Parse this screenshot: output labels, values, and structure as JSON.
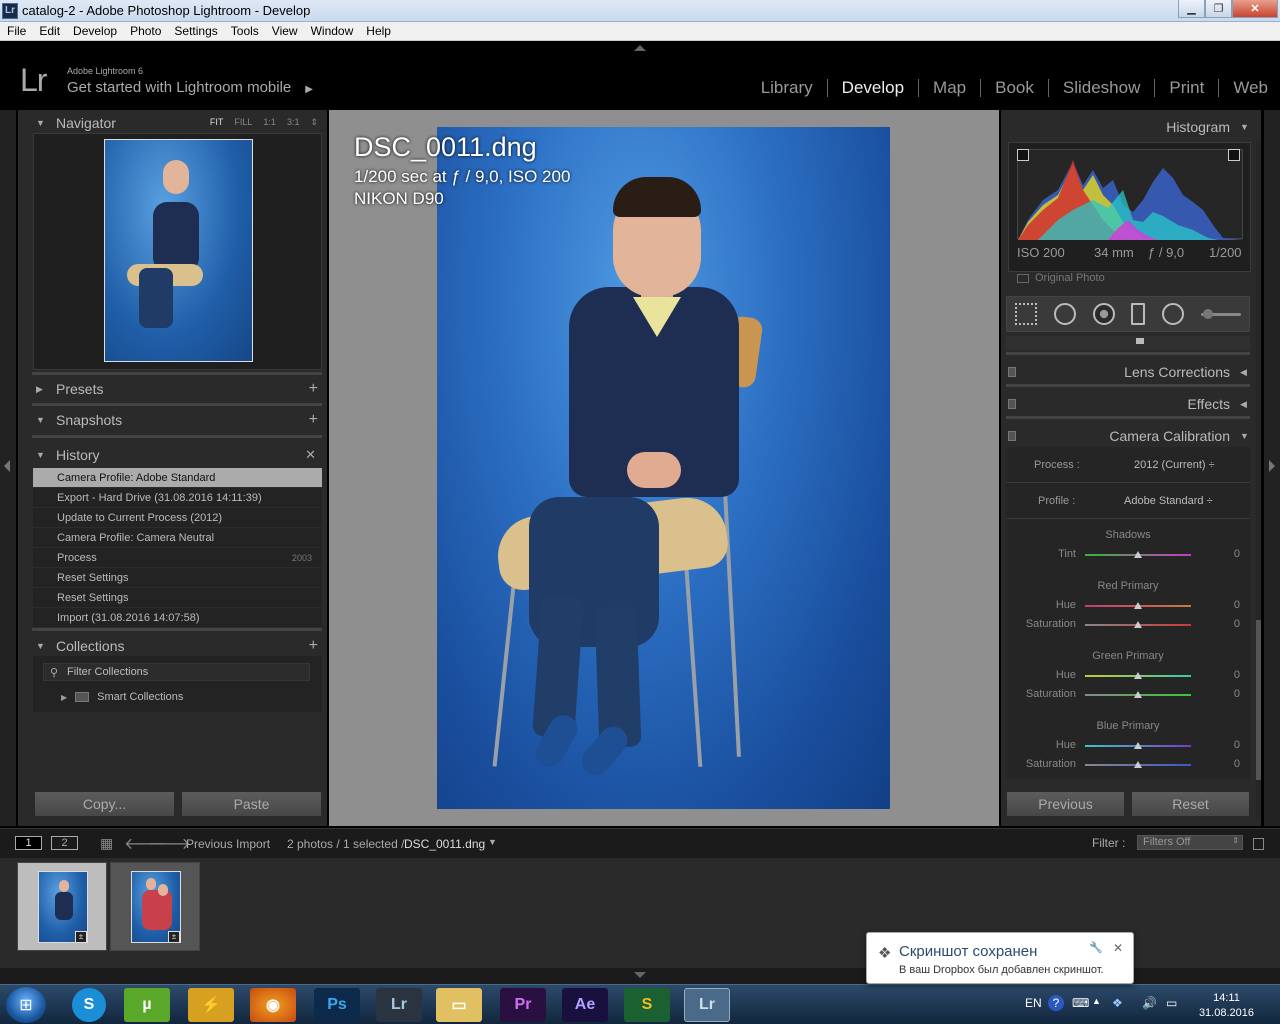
{
  "window": {
    "title": "catalog-2 - Adobe Photoshop Lightroom - Develop",
    "app_icon": "Lr"
  },
  "menu": [
    "File",
    "Edit",
    "Develop",
    "Photo",
    "Settings",
    "Tools",
    "View",
    "Window",
    "Help"
  ],
  "header": {
    "logo": "Lr",
    "product": "Adobe Lightroom 6",
    "subtitle": "Get started with Lightroom mobile",
    "modules": [
      "Library",
      "Develop",
      "Map",
      "Book",
      "Slideshow",
      "Print",
      "Web"
    ],
    "active": "Develop"
  },
  "left": {
    "navigator": {
      "title": "Navigator",
      "options": [
        "FIT",
        "FILL",
        "1:1",
        "3:1"
      ]
    },
    "presets": "Presets",
    "snapshots": "Snapshots",
    "history": {
      "title": "History",
      "items": [
        {
          "label": "Camera Profile: Adobe Standard",
          "value": ""
        },
        {
          "label": "Export - Hard Drive (31.08.2016 14:11:39)",
          "value": ""
        },
        {
          "label": "Update to Current Process (2012)",
          "value": ""
        },
        {
          "label": "Camera Profile: Camera Neutral",
          "value": ""
        },
        {
          "label": "Process",
          "value": "2003"
        },
        {
          "label": "Reset Settings",
          "value": ""
        },
        {
          "label": "Reset Settings",
          "value": ""
        },
        {
          "label": "Import (31.08.2016 14:07:58)",
          "value": ""
        }
      ]
    },
    "collections": {
      "title": "Collections",
      "filter": "Filter Collections",
      "smart": "Smart Collections"
    },
    "copy": "Copy...",
    "paste": "Paste"
  },
  "photo": {
    "filename": "DSC_0011.dng",
    "exposure": "1/200 sec at ƒ / 9,0, ISO 200",
    "camera": "NIKON D90"
  },
  "right": {
    "histogram": {
      "title": "Histogram",
      "iso": "ISO 200",
      "focal": "34 mm",
      "aperture": "ƒ / 9,0",
      "shutter": "1/200",
      "original": "Original Photo"
    },
    "lens": "Lens Corrections",
    "effects": "Effects",
    "calibration": "Camera Calibration",
    "process": {
      "label": "Process :",
      "value": "2012 (Current) ÷"
    },
    "profile": {
      "label": "Profile :",
      "value": "Adobe Standard ÷"
    },
    "shadows": {
      "title": "Shadows",
      "tint_label": "Tint",
      "tint": "0"
    },
    "red": {
      "title": "Red Primary",
      "hue_label": "Hue",
      "hue": "0",
      "sat_label": "Saturation",
      "sat": "0"
    },
    "green": {
      "title": "Green Primary",
      "hue_label": "Hue",
      "hue": "0",
      "sat_label": "Saturation",
      "sat": "0"
    },
    "blue": {
      "title": "Blue Primary",
      "hue_label": "Hue",
      "hue": "0",
      "sat_label": "Saturation",
      "sat": "0"
    },
    "previous": "Previous",
    "reset": "Reset"
  },
  "filmbar": {
    "view1": "1",
    "view2": "2",
    "source": "Previous Import",
    "count": "2 photos / 1 selected /",
    "file": "DSC_0011.dng",
    "filter_label": "Filter :",
    "filter_value": "Filters Off"
  },
  "taskbar": {
    "lang": "EN",
    "time": "14:11",
    "date": "31.08.2016",
    "apps": [
      "Ps",
      "Lr",
      "Pr",
      "Ae",
      "Lr"
    ]
  },
  "notification": {
    "title": "Скриншот сохранен",
    "message": "В ваш Dropbox был добавлен скриншот."
  }
}
